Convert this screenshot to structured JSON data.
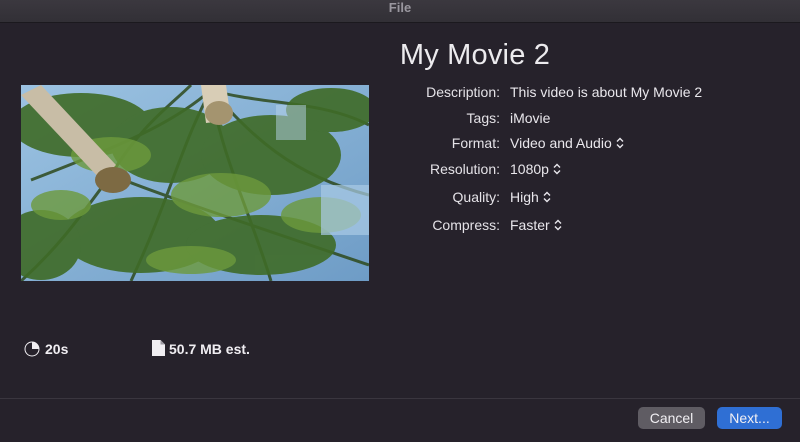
{
  "window": {
    "title": "File"
  },
  "movie": {
    "title": "My Movie 2"
  },
  "fields": {
    "description": {
      "label": "Description:",
      "value": "This video is about My Movie 2"
    },
    "tags": {
      "label": "Tags:",
      "value": "iMovie"
    },
    "format": {
      "label": "Format:",
      "value": "Video and Audio"
    },
    "resolution": {
      "label": "Resolution:",
      "value": "1080p"
    },
    "quality": {
      "label": "Quality:",
      "value": "High"
    },
    "compress": {
      "label": "Compress:",
      "value": "Faster"
    }
  },
  "stats": {
    "duration": {
      "icon": "clock-icon",
      "text": "20s"
    },
    "size": {
      "icon": "document-icon",
      "text": "50.7 MB est."
    }
  },
  "buttons": {
    "cancel": "Cancel",
    "next": "Next..."
  },
  "colors": {
    "background": "#26222b",
    "accent": "#2f6fd4",
    "secondary_button": "#5f5c63"
  }
}
